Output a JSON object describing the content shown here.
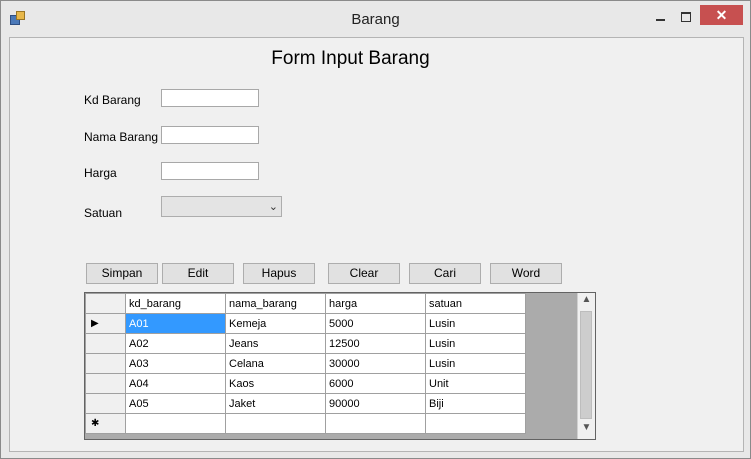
{
  "window": {
    "title": "Barang",
    "close_glyph": "✕"
  },
  "form": {
    "title": "Form Input Barang",
    "fields": {
      "kd_barang": {
        "label": "Kd Barang",
        "value": ""
      },
      "nama_barang": {
        "label": "Nama Barang",
        "value": ""
      },
      "harga": {
        "label": "Harga",
        "value": ""
      },
      "satuan": {
        "label": "Satuan",
        "value": ""
      }
    }
  },
  "buttons": {
    "simpan": "Simpan",
    "edit": "Edit",
    "hapus": "Hapus",
    "clear": "Clear",
    "cari": "Cari",
    "word": "Word"
  },
  "grid": {
    "columns": [
      "kd_barang",
      "nama_barang",
      "harga",
      "satuan"
    ],
    "rows": [
      [
        "A01",
        "Kemeja",
        "5000",
        "Lusin"
      ],
      [
        "A02",
        "Jeans",
        "12500",
        "Lusin"
      ],
      [
        "A03",
        "Celana",
        "30000",
        "Lusin"
      ],
      [
        "A04",
        "Kaos",
        "6000",
        "Unit"
      ],
      [
        "A05",
        "Jaket",
        "90000",
        "Biji"
      ]
    ],
    "current_row_marker": "▶",
    "new_row_marker": "✱",
    "selection_color": "#3399ff"
  },
  "icons": {
    "app": "app-window-icon",
    "dropdown": "chevron-down-icon",
    "scroll_up": "scroll-up-icon",
    "scroll_down": "scroll-down-icon"
  },
  "glyphs": {
    "dropdown": "⌄",
    "up": "▲",
    "down": "▼"
  }
}
